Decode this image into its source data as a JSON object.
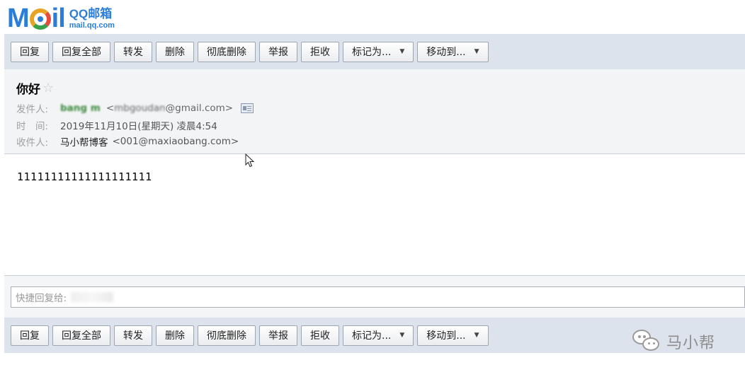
{
  "logo": {
    "brand": "Mail",
    "product": "QQ邮箱",
    "domain": "mail.qq.com"
  },
  "toolbar": {
    "reply": "回复",
    "reply_all": "回复全部",
    "forward": "转发",
    "delete": "删除",
    "delete_permanently": "彻底删除",
    "report": "举报",
    "reject": "拒收",
    "mark_as": "标记为...",
    "move_to": "移动到..."
  },
  "message": {
    "subject": "你好",
    "from_label": "发件人:",
    "from_name": "bang m",
    "from_address_prefix": "<",
    "from_address_obscured": "mbgoudan",
    "from_address_suffix": "@gmail.com>",
    "time_label": "时　间:",
    "time_value": "2019年11月10日(星期天) 凌晨4:54",
    "to_label": "收件人:",
    "to_name": "马小帮博客",
    "to_address": "<001@maxiaobang.com>",
    "body": "11111111111111111111"
  },
  "quick_reply": {
    "label": "快捷回复给:"
  },
  "watermark": {
    "text": "马小帮"
  }
}
